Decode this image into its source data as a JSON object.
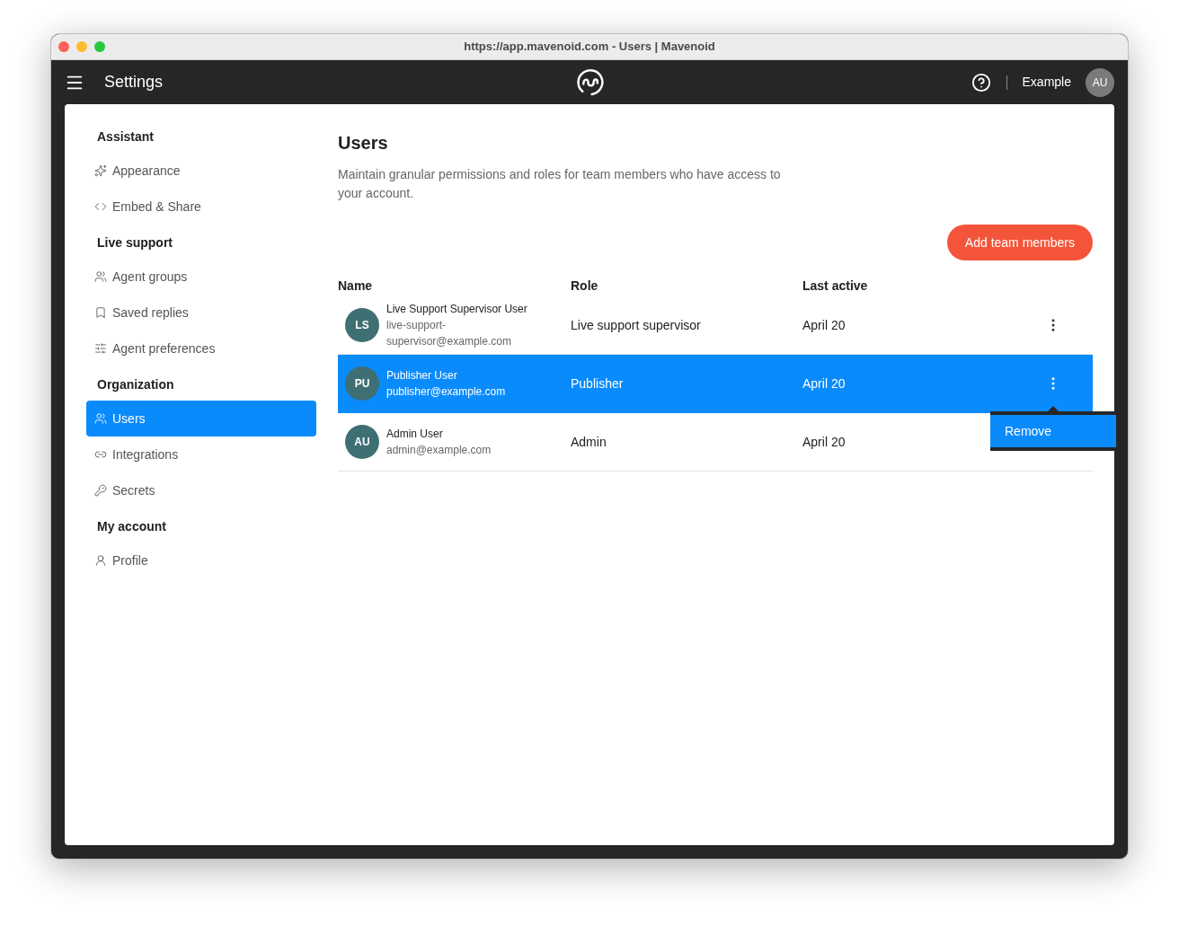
{
  "window": {
    "title": "https://app.mavenoid.com - Users | Mavenoid"
  },
  "header": {
    "title": "Settings",
    "account": "Example",
    "avatar": "AU"
  },
  "sidebar": {
    "sections": [
      {
        "title": "Assistant",
        "items": [
          {
            "label": "Appearance",
            "selected": false
          },
          {
            "label": "Embed & Share",
            "selected": false
          }
        ]
      },
      {
        "title": "Live support",
        "items": [
          {
            "label": "Agent groups",
            "selected": false
          },
          {
            "label": "Saved replies",
            "selected": false
          },
          {
            "label": "Agent preferences",
            "selected": false
          }
        ]
      },
      {
        "title": "Organization",
        "items": [
          {
            "label": "Users",
            "selected": true
          },
          {
            "label": "Integrations",
            "selected": false
          },
          {
            "label": "Secrets",
            "selected": false
          }
        ]
      },
      {
        "title": "My account",
        "items": [
          {
            "label": "Profile",
            "selected": false
          }
        ]
      }
    ]
  },
  "page": {
    "title": "Users",
    "description": "Maintain granular permissions and roles for team members who have access to your account.",
    "add_button": "Add team members"
  },
  "table": {
    "columns": [
      "Name",
      "Role",
      "Last active"
    ],
    "rows": [
      {
        "initials": "LS",
        "name": "Live Support Supervisor User",
        "email": "live-support-supervisor@example.com",
        "role": "Live support supervisor",
        "last_active": "April 20",
        "selected": false
      },
      {
        "initials": "PU",
        "name": "Publisher User",
        "email": "publisher@example.com",
        "role": "Publisher",
        "last_active": "April 20",
        "selected": true,
        "menu": {
          "items": [
            {
              "label": "Remove",
              "selected": true
            }
          ]
        }
      },
      {
        "initials": "AU",
        "name": "Admin User",
        "email": "admin@example.com",
        "role": "Admin",
        "last_active": "April 20",
        "selected": false
      }
    ]
  }
}
